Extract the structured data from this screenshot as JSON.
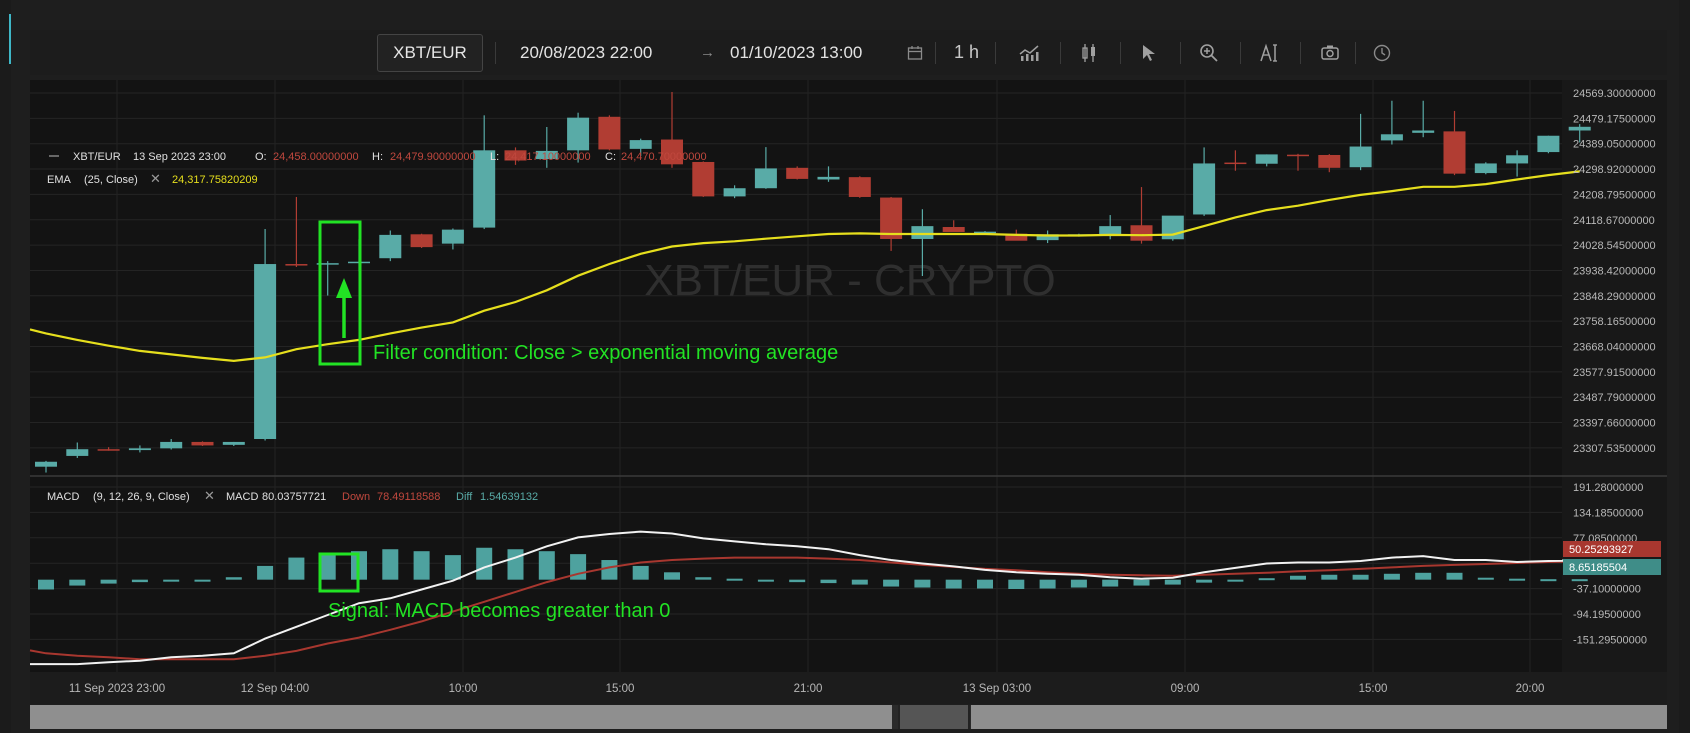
{
  "toolbar": {
    "pair": "XBT/EUR",
    "date_from": "20/08/2023 22:00",
    "date_to": "01/10/2023 13:00",
    "interval": "1 h",
    "icons": [
      "calendar-icon",
      "indicators-icon",
      "candle-type-icon",
      "cursor-icon",
      "zoom-icon",
      "text-tool-icon",
      "screenshot-icon",
      "clock-icon"
    ]
  },
  "watermark": "XBT/EUR - CRYPTO",
  "legend": {
    "pair": "XBT/EUR",
    "datetime": "13 Sep 2023 23:00",
    "o_label": "O:",
    "o_value": "24,458.00000000",
    "h_label": "H:",
    "h_value": "24,479.90000000",
    "l_label": "L:",
    "l_value": "24,417.10000000",
    "c_label": "C:",
    "c_value": "24,470.70000000",
    "ema_label": "EMA",
    "ema_params": "(25, Close)",
    "ema_value": "24,317.75820209",
    "macd_label": "MACD",
    "macd_params": "(9, 12, 26, 9, Close)",
    "macd_name": "MACD",
    "macd_value": "80.03757721",
    "down_name": "Down",
    "down_value": "78.49118588",
    "diff_name": "Diff",
    "diff_value": "1.54639132"
  },
  "annotations": {
    "filter": "Filter condition: Close > exponential moving average",
    "signal": "Signal: MACD becomes greater than 0"
  },
  "colors": {
    "up": "#59aba7",
    "down": "#b13d33",
    "ema": "#e6df1d",
    "macd": "#f2f2f2",
    "signal_line": "#a8372f",
    "annotation": "#22e324",
    "background": "#131313"
  },
  "chart_data": [
    {
      "type": "candlestick",
      "title": "XBT/EUR",
      "x_ticks": [
        "11 Sep 2023 23:00",
        "12 Sep 04:00",
        "10:00",
        "15:00",
        "21:00",
        "13 Sep 03:00",
        "09:00",
        "15:00",
        "20:00"
      ],
      "y_ticks": [
        "24569.30000000",
        "24479.17500000",
        "24389.05000000",
        "24298.92000000",
        "24208.79500000",
        "24118.67000000",
        "24028.54500000",
        "23938.42000000",
        "23848.29000000",
        "23758.16500000",
        "23668.04000000",
        "23577.91500000",
        "23487.79000000",
        "23397.66000000",
        "23307.53500000"
      ],
      "ylim": [
        23280,
        24590
      ],
      "candles": [
        {
          "o": 23305,
          "h": 23325,
          "l": 23285,
          "c": 23322
        },
        {
          "o": 23342,
          "h": 23388,
          "l": 23335,
          "c": 23365
        },
        {
          "o": 23365,
          "h": 23372,
          "l": 23360,
          "c": 23363
        },
        {
          "o": 23362,
          "h": 23378,
          "l": 23354,
          "c": 23368
        },
        {
          "o": 23368,
          "h": 23400,
          "l": 23364,
          "c": 23390
        },
        {
          "o": 23390,
          "h": 23392,
          "l": 23376,
          "c": 23378
        },
        {
          "o": 23380,
          "h": 23390,
          "l": 23376,
          "c": 23390
        },
        {
          "o": 23400,
          "h": 24120,
          "l": 23395,
          "c": 24000
        },
        {
          "o": 24000,
          "h": 24230,
          "l": 23990,
          "c": 23995
        },
        {
          "o": 23998,
          "h": 24010,
          "l": 23892,
          "c": 24003
        },
        {
          "o": 24005,
          "h": 24085,
          "l": 23975,
          "c": 24008
        },
        {
          "o": 24020,
          "h": 24115,
          "l": 24010,
          "c": 24100
        },
        {
          "o": 24102,
          "h": 24104,
          "l": 24055,
          "c": 24058
        },
        {
          "o": 24070,
          "h": 24122,
          "l": 24050,
          "c": 24118
        },
        {
          "o": 24125,
          "h": 24510,
          "l": 24120,
          "c": 24390
        },
        {
          "o": 24390,
          "h": 24400,
          "l": 24340,
          "c": 24355
        },
        {
          "o": 24360,
          "h": 24470,
          "l": 24330,
          "c": 24388
        },
        {
          "o": 24390,
          "h": 24519,
          "l": 24348,
          "c": 24502
        },
        {
          "o": 24505,
          "h": 24510,
          "l": 24390,
          "c": 24393
        },
        {
          "o": 24395,
          "h": 24430,
          "l": 24370,
          "c": 24425
        },
        {
          "o": 24427,
          "h": 24590,
          "l": 24330,
          "c": 24342
        },
        {
          "o": 24350,
          "h": 24352,
          "l": 24230,
          "c": 24232
        },
        {
          "o": 24232,
          "h": 24270,
          "l": 24226,
          "c": 24260
        },
        {
          "o": 24260,
          "h": 24401,
          "l": 24258,
          "c": 24328
        },
        {
          "o": 24330,
          "h": 24335,
          "l": 24290,
          "c": 24292
        },
        {
          "o": 24290,
          "h": 24335,
          "l": 24282,
          "c": 24299
        },
        {
          "o": 24298,
          "h": 24301,
          "l": 24227,
          "c": 24230
        },
        {
          "o": 24228,
          "h": 24230,
          "l": 24045,
          "c": 24086
        },
        {
          "o": 24086,
          "h": 24188,
          "l": 23959,
          "c": 24130
        },
        {
          "o": 24127,
          "h": 24150,
          "l": 24115,
          "c": 24110
        },
        {
          "o": 24110,
          "h": 24113,
          "l": 24104,
          "c": 24111
        },
        {
          "o": 24104,
          "h": 24118,
          "l": 24085,
          "c": 24080
        },
        {
          "o": 24082,
          "h": 24115,
          "l": 24072,
          "c": 24102
        },
        {
          "o": 24100,
          "h": 24104,
          "l": 24094,
          "c": 24102
        },
        {
          "o": 24103,
          "h": 24168,
          "l": 24085,
          "c": 24130
        },
        {
          "o": 24133,
          "h": 24264,
          "l": 24070,
          "c": 24080
        },
        {
          "o": 24085,
          "h": 24157,
          "l": 24080,
          "c": 24166
        },
        {
          "o": 24170,
          "h": 24400,
          "l": 24165,
          "c": 24345
        },
        {
          "o": 24348,
          "h": 24390,
          "l": 24320,
          "c": 24345
        },
        {
          "o": 24344,
          "h": 24376,
          "l": 24335,
          "c": 24376
        },
        {
          "o": 24375,
          "h": 24378,
          "l": 24320,
          "c": 24374
        },
        {
          "o": 24374,
          "h": 24377,
          "l": 24315,
          "c": 24330
        },
        {
          "o": 24332,
          "h": 24515,
          "l": 24322,
          "c": 24403
        },
        {
          "o": 24424,
          "h": 24560,
          "l": 24410,
          "c": 24445
        },
        {
          "o": 24450,
          "h": 24560,
          "l": 24435,
          "c": 24458
        },
        {
          "o": 24455,
          "h": 24525,
          "l": 24305,
          "c": 24310
        },
        {
          "o": 24312,
          "h": 24349,
          "l": 24308,
          "c": 24345
        },
        {
          "o": 24345,
          "h": 24390,
          "l": 24300,
          "c": 24373
        },
        {
          "o": 24384,
          "h": 24440,
          "l": 24380,
          "c": 24440
        },
        {
          "o": 24458,
          "h": 24479.9,
          "l": 24417.1,
          "c": 24470.7
        }
      ],
      "ema": [
        23762,
        23740,
        23720,
        23702,
        23690,
        23678,
        23668,
        23680,
        23708,
        23725,
        23740,
        23762,
        23782,
        23800,
        23840,
        23870,
        23910,
        23960,
        24000,
        24035,
        24060,
        24072,
        24078,
        24087,
        24095,
        24103,
        24105,
        24103,
        24103,
        24103,
        24103,
        24100,
        24098,
        24098,
        24100,
        24099,
        24101,
        24130,
        24160,
        24185,
        24200,
        24220,
        24237,
        24250,
        24265,
        24265,
        24274,
        24290,
        24305,
        24317.76
      ]
    },
    {
      "type": "bar",
      "title": "MACD (9, 12, 26, 9, Close)",
      "y_ticks": [
        "191.28000000",
        "134.18500000",
        "77.08500000",
        "20.00000000",
        "-37.10000000",
        "-94.19500000",
        "-151.29500000"
      ],
      "ylim": [
        -186,
        203
      ],
      "last_values": {
        "down": "50.25293927",
        "diff": "8.65185504"
      },
      "histogram": [
        -20,
        -12,
        -8,
        -5,
        -2,
        0,
        5,
        28,
        45,
        52,
        58,
        62,
        58,
        50,
        65,
        62,
        58,
        52,
        40,
        28,
        15,
        5,
        2,
        -2,
        -5,
        -7,
        -10,
        -14,
        -16,
        -18,
        -18,
        -19,
        -18,
        -16,
        -14,
        -12,
        -10,
        -6,
        -2,
        3,
        8,
        10,
        10,
        12,
        14,
        14,
        4,
        2,
        1,
        1
      ],
      "macd_line": [
        -172,
        -172,
        -168,
        -165,
        -158,
        -155,
        -150,
        -120,
        -96,
        -72,
        -48,
        -38,
        -20,
        -2,
        25,
        45,
        68,
        86,
        93,
        98,
        94,
        84,
        78,
        72,
        68,
        62,
        50,
        40,
        33,
        27,
        20,
        15,
        12,
        10,
        5,
        2,
        4,
        15,
        24,
        33,
        35,
        35,
        38,
        45,
        48,
        40,
        40,
        36,
        38,
        39
      ],
      "signal_line": [
        -150,
        -155,
        -158,
        -162,
        -162,
        -162,
        -162,
        -155,
        -145,
        -130,
        -118,
        -102,
        -85,
        -65,
        -45,
        -25,
        -5,
        12,
        25,
        35,
        40,
        43,
        45,
        45,
        45,
        43,
        40,
        35,
        30,
        26,
        22,
        19,
        15,
        12,
        10,
        9,
        8,
        10,
        12,
        14,
        17,
        19,
        22,
        25,
        28,
        30,
        32,
        34,
        36,
        37
      ]
    }
  ]
}
